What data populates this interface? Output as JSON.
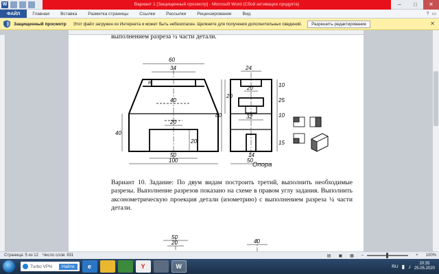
{
  "window": {
    "title": "Вариант 1 [Защищенный просмотр] - Microsoft Word (Сбой активации продукта)",
    "minimize": "–",
    "maximize": "□",
    "close": "✕",
    "logo": "W"
  },
  "ribbon": {
    "tabs": [
      "ФАЙЛ",
      "Главная",
      "Вставка",
      "Разметка страницы",
      "Ссылки",
      "Рассылки",
      "Рецензирование",
      "Вид"
    ]
  },
  "protected_view": {
    "title": "Защищенный просмотр",
    "message": "Этот файл загружен из Интернета и может быть небезопасен. Щелкните для получения дополнительных сведений.",
    "button": "Разрешить редактирование",
    "close": "✕"
  },
  "document": {
    "top_line": "выполнением разреза ¼ части детали.",
    "caption": "Опора",
    "paragraph": "Вариант 10. Задание: По двум видам построить третий, выполнить необходимые разрезы. Выполнение разрезов показано на схеме в правом углу задания. Выполнить аксонометрическую проекция детали (изометрию) с выполнением разреза ¼ части детали.",
    "dims_front": {
      "top": "60",
      "inner_top": "34",
      "r": "R",
      "right": "20",
      "mid": "40",
      "hole": "20",
      "height": "20",
      "left": "40",
      "bottom_inner": "50",
      "total": "100"
    },
    "dims_side": {
      "top": "24",
      "a": "20",
      "b": "10",
      "c": "25",
      "d": "32",
      "e": "10",
      "f": "14",
      "g": "15",
      "total": "50",
      "height": "80"
    },
    "dims_bottom": {
      "a": "50",
      "b": "20",
      "c": "40"
    }
  },
  "status": {
    "page": "Страница: 5 из 12",
    "words": "Число слов: 831",
    "zoom": "100%"
  },
  "taskbar": {
    "vpn_label": "Turbo VPN",
    "vpn_button": "Найти",
    "lang": "RU",
    "time": "20:35",
    "date": "25.05.2020",
    "word_label": "W"
  }
}
